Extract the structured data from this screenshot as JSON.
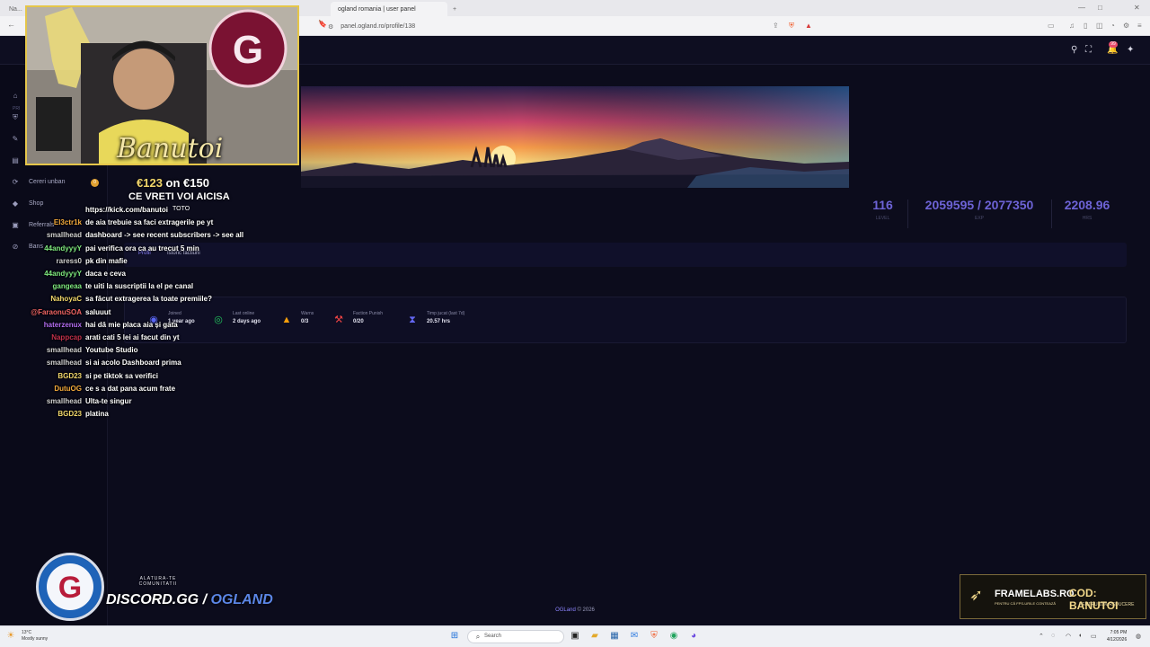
{
  "browser": {
    "tabs": [
      {
        "label": "Na...",
        "active": false
      },
      {
        "label": "ogland romania | user panel",
        "active": true
      }
    ],
    "new_tab": "+",
    "url": "panel.ogland.ro/profile/138"
  },
  "sidebar": {
    "heading": "PRI",
    "items": [
      {
        "label": "Cereri unban",
        "icon": "ban-request-icon",
        "badge": "0"
      },
      {
        "label": "Shop",
        "icon": "diamond-icon"
      },
      {
        "label": "Referrals",
        "icon": "gift-icon"
      },
      {
        "label": "Bans",
        "icon": "ban-icon"
      }
    ]
  },
  "profile": {
    "stats": [
      {
        "value": "116",
        "label": "LEVEL"
      },
      {
        "value": "2059595 / 2077350",
        "label": "EXP"
      },
      {
        "value": "2208.96",
        "label": "HRS"
      }
    ],
    "tabs": [
      {
        "label": "Profil",
        "active": true
      },
      {
        "label": "Istoric factiuni",
        "active": false
      }
    ],
    "info": [
      {
        "label": "Joined",
        "value": "1 year ago",
        "icon": "discord-icon",
        "color": "#5865f2"
      },
      {
        "label": "Last online",
        "value": "2 days ago",
        "icon": "gamepad-icon",
        "color": "#22c55e"
      },
      {
        "label": "Warns",
        "value": "0/3",
        "icon": "warning-icon",
        "color": "#f59e0b"
      },
      {
        "label": "Faction Punish",
        "value": "0/20",
        "icon": "hammer-icon",
        "color": "#ef4444"
      },
      {
        "label": "Timp jucat (last 7d)",
        "value": "20.57 hrs",
        "icon": "hourglass-icon",
        "color": "#6366f1"
      }
    ]
  },
  "footer": {
    "brand": "OGLand",
    "text": " © 2026"
  },
  "stream": {
    "streamer": "Banutoi",
    "goal_current": "€123",
    "goal_on": " on ",
    "goal_target": "€150",
    "goal_title": "CE VRETI VOI AICISA",
    "goal_sub": "TOTO",
    "discord_cta": "ALATURA-TE COMUNITATII",
    "discord_link_a": "DISCORD.GG / ",
    "discord_link_b": "OGLAND",
    "sponsor_brand": "FRAMELABS.RO",
    "sponsor_brand_sub": "PENTRU CĂ FPS-URILE CONTEAZĂ",
    "sponsor_code": "COD: BANUTOI",
    "sponsor_code_sub": "PENTRU 10% REDUCERE"
  },
  "chat": [
    {
      "user": "",
      "msg": "https://kick.com/banutoi",
      "color": "#ffffff"
    },
    {
      "user": "El3ctr1k",
      "msg": "de aia trebuie sa faci extragerile pe yt",
      "color": "#f2a93b"
    },
    {
      "user": "smallhead",
      "msg": "dashboard -> see recent subscribers -> see all",
      "color": "#d0d0d0"
    },
    {
      "user": "44andyyyY",
      "msg": "pai verifica ora ca au trecut 5 min",
      "color": "#7ee87e"
    },
    {
      "user": "raress0",
      "msg": "pk din mafie",
      "color": "#d0d0d0"
    },
    {
      "user": "44andyyyY",
      "msg": "daca e ceva",
      "color": "#7ee87e"
    },
    {
      "user": "gangeaa",
      "msg": "te uiti la suscriptii la el pe canal",
      "color": "#7ee87e"
    },
    {
      "user": "NahoyaC",
      "msg": "sa făcut extragerea la toate premiile?",
      "color": "#f2d86b"
    },
    {
      "user": "@FaraonuSOA",
      "msg": "saluuut",
      "color": "#f06464"
    },
    {
      "user": "haterzenux",
      "msg": "hai dă mie placa aia și gata",
      "color": "#b16cf0"
    },
    {
      "user": "Nappcap",
      "msg": "arati cati 5 lei ai facut din yt",
      "color": "#c0304a"
    },
    {
      "user": "smallhead",
      "msg": "Youtube Studio",
      "color": "#d0d0d0"
    },
    {
      "user": "smallhead",
      "msg": "si ai acolo Dashboard prima",
      "color": "#d0d0d0"
    },
    {
      "user": "BGD23",
      "msg": "si pe tiktok sa verifici",
      "color": "#f2d86b"
    },
    {
      "user": "DutuOG",
      "msg": "ce s a dat pana acum frate",
      "color": "#f2a93b"
    },
    {
      "user": "smallhead",
      "msg": "Ulta-te singur",
      "color": "#d0d0d0"
    },
    {
      "user": "BGD23",
      "msg": "platina",
      "color": "#f2d86b"
    }
  ],
  "taskbar": {
    "weather_temp": "13°C",
    "weather_desc": "Mostly sunny",
    "search_placeholder": "Search",
    "time": "7:05 PM",
    "date": "4/12/2026"
  }
}
